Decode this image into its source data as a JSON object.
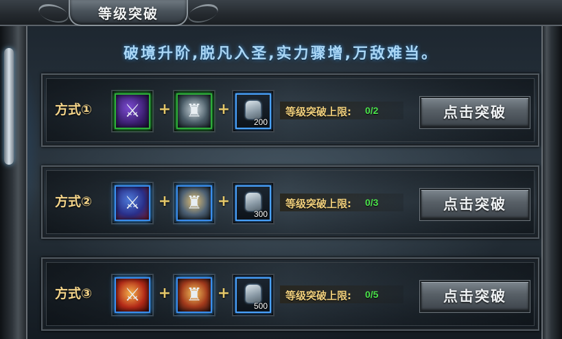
{
  "window": {
    "title": "等级突破"
  },
  "slogan": "破境升阶,脱凡入圣,实力骤增,万敌难当。",
  "methods": [
    {
      "label": "方式①",
      "item1_icon": "sword-icon",
      "item2_icon": "armor-icon",
      "stone_icon": "stone-icon",
      "stone_count": "200",
      "limit_label": "等级突破上限:",
      "limit_value": "0/2",
      "button_label": "点击突破",
      "border_color": "#2fae3a"
    },
    {
      "label": "方式②",
      "item1_icon": "sword-icon",
      "item2_icon": "armor-icon",
      "stone_icon": "stone-icon",
      "stone_count": "300",
      "limit_label": "等级突破上限:",
      "limit_value": "0/3",
      "button_label": "点击突破",
      "border_color": "#3b8ff0"
    },
    {
      "label": "方式③",
      "item1_icon": "sword-icon",
      "item2_icon": "armor-icon",
      "stone_icon": "stone-icon",
      "stone_count": "500",
      "limit_label": "等级突破上限:",
      "limit_value": "0/5",
      "button_label": "点击突破",
      "border_color": "#3b8ff0"
    }
  ],
  "plus_sign": "+",
  "colors": {
    "limit_value": "#4be34b",
    "label_gold": "#f0cf7c",
    "slogan": "#a9d6f5"
  }
}
